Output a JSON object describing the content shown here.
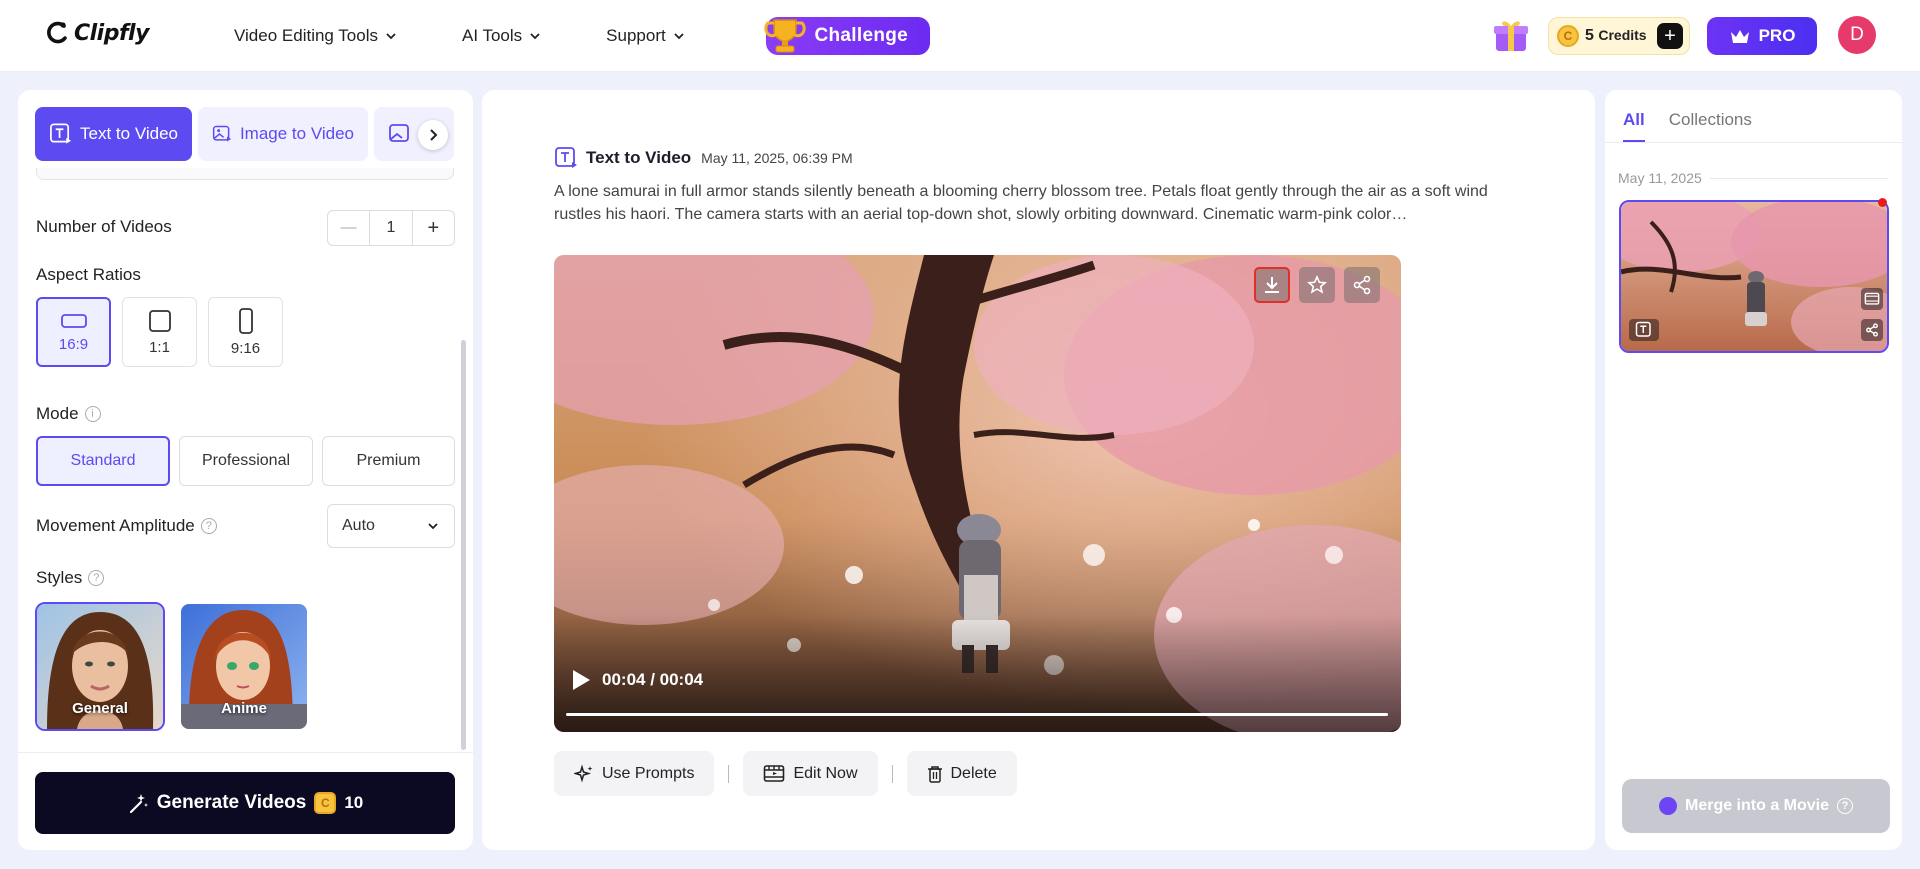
{
  "header": {
    "logo_text": "Clipfly",
    "nav": [
      {
        "label": "Video Editing Tools"
      },
      {
        "label": "AI Tools"
      },
      {
        "label": "Support"
      }
    ],
    "challenge_label": "Challenge",
    "credits_count": "5",
    "credits_label": "Credits",
    "credits_plus": "+",
    "coin_symbol": "C",
    "pro_label": "PRO",
    "avatar_letter": "D"
  },
  "left": {
    "tabs": [
      {
        "label": "Text to Video",
        "active": true
      },
      {
        "label": "Image to Video",
        "active": false
      }
    ],
    "number_of_videos_label": "Number of Videos",
    "number_of_videos_value": "1",
    "stepper_minus": "—",
    "stepper_plus": "+",
    "aspect_ratios_label": "Aspect Ratios",
    "aspect_ratios": [
      {
        "label": "16:9",
        "active": true
      },
      {
        "label": "1:1",
        "active": false
      },
      {
        "label": "9:16",
        "active": false
      }
    ],
    "mode_label": "Mode",
    "info_symbol": "i",
    "help_symbol": "?",
    "modes": [
      {
        "label": "Standard",
        "active": true
      },
      {
        "label": "Professional",
        "active": false
      },
      {
        "label": "Premium",
        "active": false
      }
    ],
    "movement_label": "Movement Amplitude",
    "movement_value": "Auto",
    "styles_label": "Styles",
    "styles": [
      {
        "label": "General",
        "active": true
      },
      {
        "label": "Anime",
        "active": false
      }
    ],
    "generate_label": "Generate Videos",
    "generate_cost": "10"
  },
  "center": {
    "entry_type": "Text to Video",
    "entry_date": "May 11, 2025, 06:39 PM",
    "prompt": "A lone samurai in full armor stands silently beneath a blooming cherry blossom tree. Petals float gently through the air as a soft wind rustles his haori. The camera starts with an aerial top-down shot, slowly orbiting downward. Cinematic warm-pink color…",
    "video_time": "00:04 / 00:04",
    "video_progress": 1.0,
    "actions": [
      {
        "label": "Use Prompts"
      },
      {
        "label": "Edit Now"
      },
      {
        "label": "Delete"
      }
    ]
  },
  "right": {
    "tabs": [
      {
        "label": "All",
        "active": true
      },
      {
        "label": "Collections",
        "active": false
      }
    ],
    "date_group": "May 11, 2025",
    "merge_label": "Merge into a Movie",
    "merge_help": "?"
  },
  "colors": {
    "accent": "#5b4bf0",
    "challenge": "#7b35f4",
    "generate_bg": "#0b0a22",
    "avatar": "#e63a6a",
    "notification_dot": "#e81c1c"
  },
  "icons": [
    "logo-icon",
    "chevron-down-icon",
    "trophy-icon",
    "gift-icon",
    "coin-icon",
    "plus-icon",
    "crown-icon",
    "text-video-icon",
    "image-video-icon",
    "chevron-right-icon",
    "info-icon",
    "help-icon",
    "wand-icon",
    "download-icon",
    "star-icon",
    "share-icon",
    "play-icon",
    "sparkle-icon",
    "film-edit-icon",
    "trash-icon"
  ]
}
